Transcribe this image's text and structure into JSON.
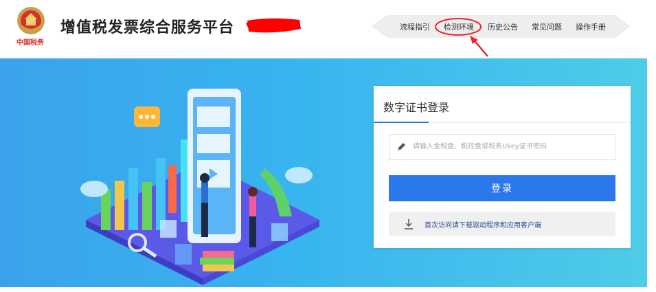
{
  "header": {
    "emblem_caption": "中国税务",
    "title": "增值税发票综合服务平台",
    "nav": [
      "流程指引",
      "检测环境",
      "历史公告",
      "常见问题",
      "操作手册"
    ]
  },
  "login": {
    "tab_label": "数字证书登录",
    "password_placeholder": "请输入金税盘、税控盘或税务Ukey证书密码",
    "password_value": "",
    "login_label": "登录",
    "download_text": "首次访问请下载驱动程序和应用客户端"
  },
  "colors": {
    "primary": "#2b77ec",
    "annotation": "#e8262a",
    "banner_start": "#3aa2ec",
    "banner_end": "#4ecce8"
  },
  "icons": [
    "tax-emblem-icon",
    "pen-icon",
    "download-arrow-icon"
  ]
}
